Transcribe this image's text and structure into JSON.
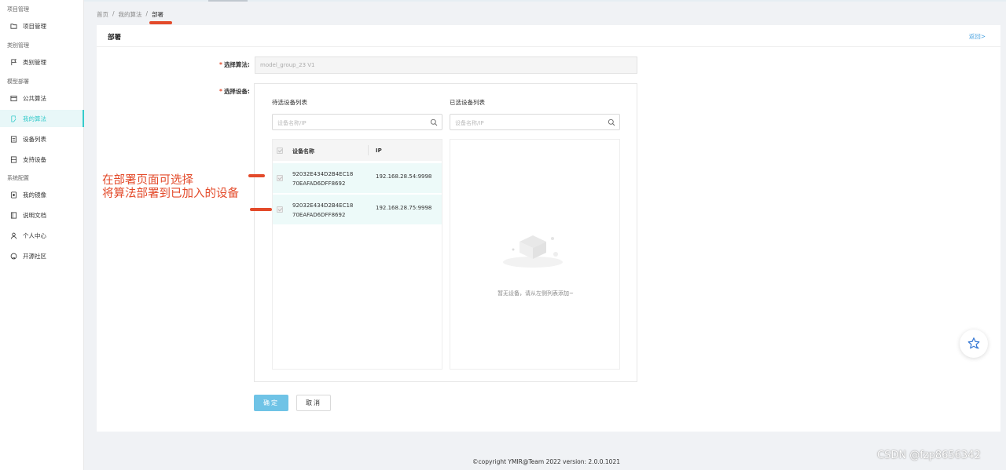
{
  "sidebar": {
    "groups": [
      "项目管理",
      "类别管理",
      "模型部署",
      "系统配置"
    ],
    "items": [
      {
        "label": "项目管理",
        "icon": "folder-icon"
      },
      {
        "label": "类别管理",
        "icon": "flag-icon"
      },
      {
        "label": "公共算法",
        "icon": "storefront-icon"
      },
      {
        "label": "我的算法",
        "icon": "document-edit-icon",
        "active": true
      },
      {
        "label": "设备列表",
        "icon": "list-box-icon"
      },
      {
        "label": "支持设备",
        "icon": "grid-box-icon"
      },
      {
        "label": "我的镜像",
        "icon": "disc-icon"
      },
      {
        "label": "说明文档",
        "icon": "book-icon"
      },
      {
        "label": "个人中心",
        "icon": "user-icon"
      },
      {
        "label": "开源社区",
        "icon": "github-icon"
      }
    ]
  },
  "breadcrumb": [
    "首页",
    "/",
    "我的算法",
    "/",
    "部署"
  ],
  "page": {
    "title": "部署",
    "back": "返回>",
    "model_label": "选择算法:",
    "model_value": "model_group_23 V1",
    "device_label": "选择设备:",
    "required_mark": "*"
  },
  "device_picker": {
    "left_title": "待选设备列表",
    "right_title": "已选设备列表",
    "left_placeholder": "设备名称/IP",
    "right_placeholder": "设备名称/IP",
    "columns": [
      "设备名称",
      "IP"
    ],
    "rows": [
      {
        "name_line1": "92032E434D2B4EC18",
        "name_line2": "70EAFAD6DFF8692",
        "ip": "192.168.28.54:9998"
      },
      {
        "name_line1": "92032E434D2B4EC18",
        "name_line2": "70EAFAD6DFF8692",
        "ip": "192.168.28.75:9998"
      }
    ],
    "empty_text": "暂无设备，请从左侧列表添加~"
  },
  "actions": {
    "ok": "确定",
    "cancel": "取消"
  },
  "annotation": {
    "line1": "在部署页面可选择",
    "line2": "将算法部署到已加入的设备",
    "color": "#e34a2a"
  },
  "footer": "©copyright YMIR@Team 2022 version: 2.0.0.1021",
  "watermark": "CSDN @fzp8656342",
  "colors": {
    "accent": "#36cbcb",
    "primary_button": "#6fc3e6",
    "annotation": "#e34a2a",
    "link": "#4ba3e0"
  }
}
